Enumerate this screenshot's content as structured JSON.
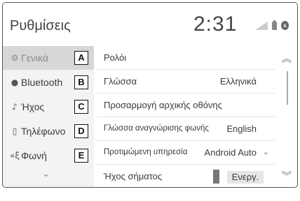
{
  "header": {
    "title": "Ρυθμίσεις",
    "clock": "2:31",
    "status_icons": [
      "signal-icon",
      "battery-icon",
      "bluetooth-status-icon"
    ]
  },
  "sidebar": {
    "items": [
      {
        "icon": "gear-icon",
        "glyph": "⚙",
        "label": "Γενικά",
        "letter": "A",
        "active": true
      },
      {
        "icon": "bluetooth-icon",
        "glyph": "●",
        "label": "Bluetooth",
        "letter": "B",
        "active": false
      },
      {
        "icon": "music-note-icon",
        "glyph": "♪",
        "label": "Ήχος",
        "letter": "C",
        "active": false
      },
      {
        "icon": "phone-icon",
        "glyph": "▯",
        "label": "Τηλέφωνο",
        "letter": "D",
        "active": false
      },
      {
        "icon": "voice-icon",
        "glyph": "«ξ",
        "label": "Φωνή",
        "letter": "E",
        "active": false
      }
    ]
  },
  "settings": {
    "rows": [
      {
        "label": "Ρολόι",
        "value": ""
      },
      {
        "label": "Γλώσσα",
        "value": "Ελληνικά"
      },
      {
        "label": "Προσαρμογή αρχικής οθόνης",
        "value": ""
      },
      {
        "label": "Γλώσσα αναγνώρισης φωνής",
        "value": "English"
      },
      {
        "label": "Προτιμώμενη υπηρεσία",
        "value": "Android Auto"
      },
      {
        "label": "Ήχος σήματος",
        "value": "Ενεργ."
      }
    ]
  }
}
